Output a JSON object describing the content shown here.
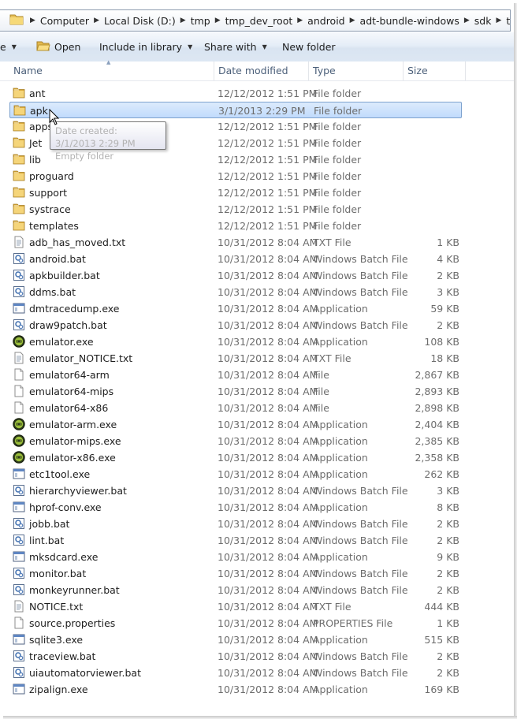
{
  "address": {
    "crumbs": [
      "Computer",
      "Local Disk (D:)",
      "tmp",
      "tmp_dev_root",
      "android",
      "adt-bundle-windows",
      "sdk",
      "tools"
    ]
  },
  "toolbar": {
    "partial_label": "e",
    "open_label": "Open",
    "include_label": "Include in library",
    "share_label": "Share with",
    "new_folder_label": "New folder"
  },
  "columns": {
    "name": "Name",
    "date": "Date modified",
    "type": "Type",
    "size": "Size"
  },
  "tooltip": {
    "line1": "Date created: 3/1/2013 2:29 PM",
    "line2": "Empty folder"
  },
  "files": [
    {
      "name": "ant",
      "date": "12/12/2012 1:51 PM",
      "type": "File folder",
      "size": "",
      "icon": "folder-icon"
    },
    {
      "name": "apk",
      "date": "3/1/2013 2:29 PM",
      "type": "File folder",
      "size": "",
      "icon": "folder-icon",
      "selected": true
    },
    {
      "name": "apps",
      "date": "12/12/2012 1:51 PM",
      "type": "File folder",
      "size": "",
      "icon": "folder-icon"
    },
    {
      "name": "Jet",
      "date": "12/12/2012 1:51 PM",
      "type": "File folder",
      "size": "",
      "icon": "folder-icon"
    },
    {
      "name": "lib",
      "date": "12/12/2012 1:51 PM",
      "type": "File folder",
      "size": "",
      "icon": "folder-icon"
    },
    {
      "name": "proguard",
      "date": "12/12/2012 1:51 PM",
      "type": "File folder",
      "size": "",
      "icon": "folder-icon"
    },
    {
      "name": "support",
      "date": "12/12/2012 1:51 PM",
      "type": "File folder",
      "size": "",
      "icon": "folder-icon"
    },
    {
      "name": "systrace",
      "date": "12/12/2012 1:51 PM",
      "type": "File folder",
      "size": "",
      "icon": "folder-icon"
    },
    {
      "name": "templates",
      "date": "12/12/2012 1:51 PM",
      "type": "File folder",
      "size": "",
      "icon": "folder-icon"
    },
    {
      "name": "adb_has_moved.txt",
      "date": "10/31/2012 8:04 AM",
      "type": "TXT File",
      "size": "1 KB",
      "icon": "text-file-icon"
    },
    {
      "name": "android.bat",
      "date": "10/31/2012 8:04 AM",
      "type": "Windows Batch File",
      "size": "4 KB",
      "icon": "batch-file-icon"
    },
    {
      "name": "apkbuilder.bat",
      "date": "10/31/2012 8:04 AM",
      "type": "Windows Batch File",
      "size": "2 KB",
      "icon": "batch-file-icon"
    },
    {
      "name": "ddms.bat",
      "date": "10/31/2012 8:04 AM",
      "type": "Windows Batch File",
      "size": "3 KB",
      "icon": "batch-file-icon"
    },
    {
      "name": "dmtracedump.exe",
      "date": "10/31/2012 8:04 AM",
      "type": "Application",
      "size": "59 KB",
      "icon": "application-icon"
    },
    {
      "name": "draw9patch.bat",
      "date": "10/31/2012 8:04 AM",
      "type": "Windows Batch File",
      "size": "2 KB",
      "icon": "batch-file-icon"
    },
    {
      "name": "emulator.exe",
      "date": "10/31/2012 8:04 AM",
      "type": "Application",
      "size": "108 KB",
      "icon": "emulator-icon"
    },
    {
      "name": "emulator_NOTICE.txt",
      "date": "10/31/2012 8:04 AM",
      "type": "TXT File",
      "size": "18 KB",
      "icon": "text-file-icon"
    },
    {
      "name": "emulator64-arm",
      "date": "10/31/2012 8:04 AM",
      "type": "File",
      "size": "2,867 KB",
      "icon": "blank-file-icon"
    },
    {
      "name": "emulator64-mips",
      "date": "10/31/2012 8:04 AM",
      "type": "File",
      "size": "2,893 KB",
      "icon": "blank-file-icon"
    },
    {
      "name": "emulator64-x86",
      "date": "10/31/2012 8:04 AM",
      "type": "File",
      "size": "2,898 KB",
      "icon": "blank-file-icon"
    },
    {
      "name": "emulator-arm.exe",
      "date": "10/31/2012 8:04 AM",
      "type": "Application",
      "size": "2,404 KB",
      "icon": "emulator-icon"
    },
    {
      "name": "emulator-mips.exe",
      "date": "10/31/2012 8:04 AM",
      "type": "Application",
      "size": "2,385 KB",
      "icon": "emulator-icon"
    },
    {
      "name": "emulator-x86.exe",
      "date": "10/31/2012 8:04 AM",
      "type": "Application",
      "size": "2,358 KB",
      "icon": "emulator-icon"
    },
    {
      "name": "etc1tool.exe",
      "date": "10/31/2012 8:04 AM",
      "type": "Application",
      "size": "262 KB",
      "icon": "application-icon"
    },
    {
      "name": "hierarchyviewer.bat",
      "date": "10/31/2012 8:04 AM",
      "type": "Windows Batch File",
      "size": "3 KB",
      "icon": "batch-file-icon"
    },
    {
      "name": "hprof-conv.exe",
      "date": "10/31/2012 8:04 AM",
      "type": "Application",
      "size": "8 KB",
      "icon": "application-icon"
    },
    {
      "name": "jobb.bat",
      "date": "10/31/2012 8:04 AM",
      "type": "Windows Batch File",
      "size": "2 KB",
      "icon": "batch-file-icon"
    },
    {
      "name": "lint.bat",
      "date": "10/31/2012 8:04 AM",
      "type": "Windows Batch File",
      "size": "2 KB",
      "icon": "batch-file-icon"
    },
    {
      "name": "mksdcard.exe",
      "date": "10/31/2012 8:04 AM",
      "type": "Application",
      "size": "9 KB",
      "icon": "application-icon"
    },
    {
      "name": "monitor.bat",
      "date": "10/31/2012 8:04 AM",
      "type": "Windows Batch File",
      "size": "2 KB",
      "icon": "batch-file-icon"
    },
    {
      "name": "monkeyrunner.bat",
      "date": "10/31/2012 8:04 AM",
      "type": "Windows Batch File",
      "size": "2 KB",
      "icon": "batch-file-icon"
    },
    {
      "name": "NOTICE.txt",
      "date": "10/31/2012 8:04 AM",
      "type": "TXT File",
      "size": "444 KB",
      "icon": "text-file-icon"
    },
    {
      "name": "source.properties",
      "date": "10/31/2012 8:04 AM",
      "type": "PROPERTIES File",
      "size": "1 KB",
      "icon": "blank-file-icon"
    },
    {
      "name": "sqlite3.exe",
      "date": "10/31/2012 8:04 AM",
      "type": "Application",
      "size": "515 KB",
      "icon": "application-icon"
    },
    {
      "name": "traceview.bat",
      "date": "10/31/2012 8:04 AM",
      "type": "Windows Batch File",
      "size": "2 KB",
      "icon": "batch-file-icon"
    },
    {
      "name": "uiautomatorviewer.bat",
      "date": "10/31/2012 8:04 AM",
      "type": "Windows Batch File",
      "size": "2 KB",
      "icon": "batch-file-icon"
    },
    {
      "name": "zipalign.exe",
      "date": "10/31/2012 8:04 AM",
      "type": "Application",
      "size": "169 KB",
      "icon": "application-icon"
    }
  ]
}
